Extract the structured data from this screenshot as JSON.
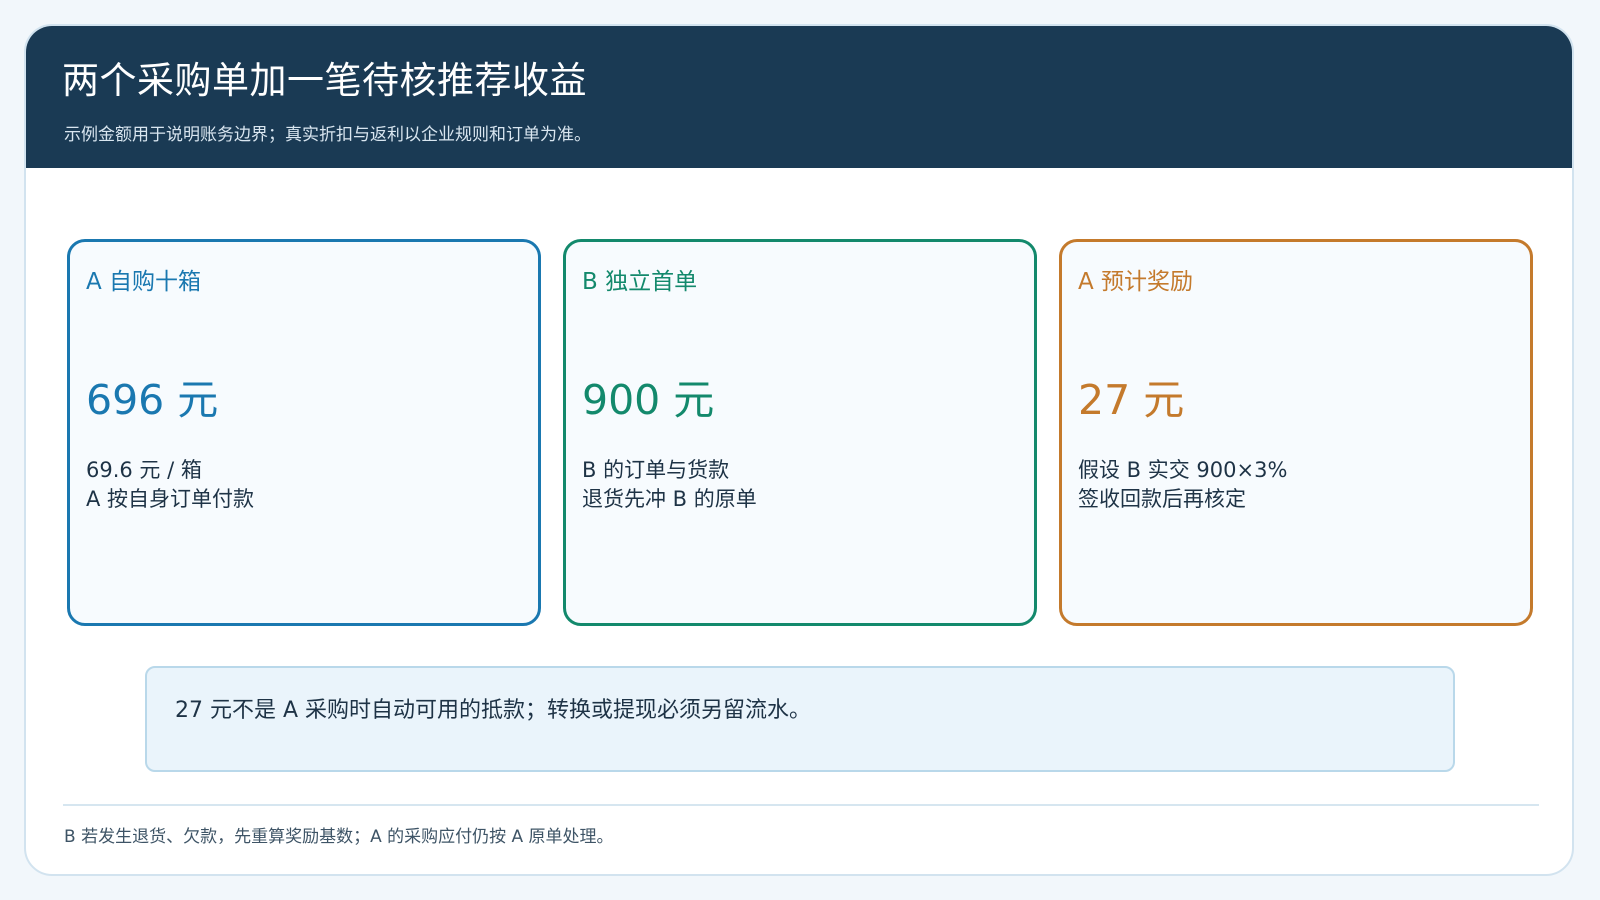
{
  "header": {
    "title": "两个采购单加一笔待核推荐收益",
    "subtitle": "示例金额用于说明账务边界；真实折扣与返利以企业规则和订单为准。"
  },
  "cards": [
    {
      "label": "A 自购十箱",
      "value": "696 元",
      "line1": "69.6 元 / 箱",
      "line2": "A 按自身订单付款",
      "color": "#1a78b0"
    },
    {
      "label": "B 独立首单",
      "value": "900 元",
      "line1": "B 的订单与货款",
      "line2": "退货先冲 B 的原单",
      "color": "#13896c"
    },
    {
      "label": "A 预计奖励",
      "value": "27 元",
      "line1": "假设 B 实交 900×3%",
      "line2": "签收回款后再核定",
      "color": "#c47a2c"
    }
  ],
  "note": {
    "text": "27 元不是 A 采购时自动可用的抵款；转换或提现必须另留流水。"
  },
  "footer": {
    "text": "B 若发生退货、欠款，先重算奖励基数；A 的采购应付仍按 A 原单处理。"
  },
  "colors": {
    "header_bg": "#1a3a54",
    "page_bg": "#f2f7fb"
  }
}
